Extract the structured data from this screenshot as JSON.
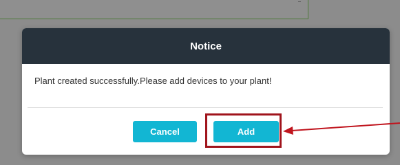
{
  "dialog": {
    "title": "Notice",
    "message": "Plant created successfully.Please add devices to your plant!",
    "cancel_label": "Cancel",
    "add_label": "Add"
  },
  "colors": {
    "header_bg": "#27323c",
    "button_bg": "#12b6d3",
    "annotation": "#a0141c",
    "overlay": "#8c8c8c"
  },
  "annotation": {
    "icon": "arrow-left-icon"
  }
}
